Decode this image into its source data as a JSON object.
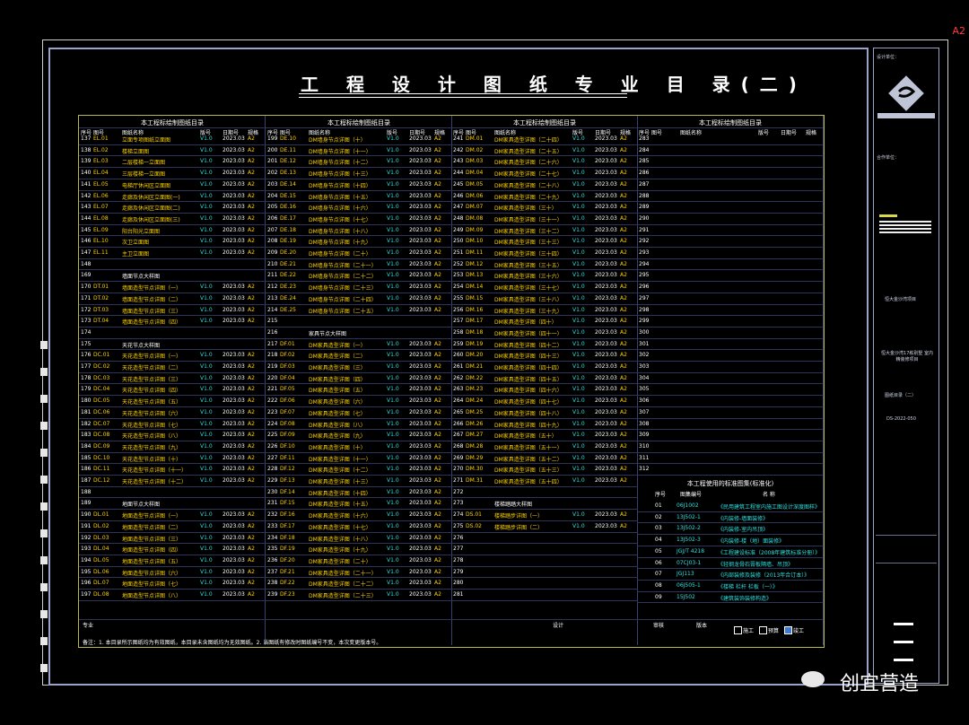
{
  "corner_label": "A2",
  "title": "工 程 设 计 图 纸 专 业 目 录(二)",
  "sections": [
    "本工程标绘制图纸目录",
    "本工程标绘制图纸目录",
    "本工程标绘制图纸目录",
    "本工程标绘制图纸目录"
  ],
  "headers": [
    "序号",
    "图号",
    "图纸名称",
    "版号",
    "日期号",
    "规格"
  ],
  "col1_rows": [
    {
      "n": "137",
      "c": "EL.01",
      "t": "立面专项图纸立面图",
      "v": "V1.0",
      "d": "2023.03",
      "s": "A2"
    },
    {
      "n": "138",
      "c": "EL.02",
      "t": "楼梯立面图",
      "v": "V1.0",
      "d": "2023.03",
      "s": "A2"
    },
    {
      "n": "139",
      "c": "EL.03",
      "t": "二层楼梯一立面图",
      "v": "V1.0",
      "d": "2023.03",
      "s": "A2"
    },
    {
      "n": "140",
      "c": "EL.04",
      "t": "三层楼梯一立面图",
      "v": "V1.0",
      "d": "2023.03",
      "s": "A2"
    },
    {
      "n": "141",
      "c": "EL.05",
      "t": "电梯厅休闲区立面图",
      "v": "V1.0",
      "d": "2023.03",
      "s": "A2"
    },
    {
      "n": "142",
      "c": "EL.06",
      "t": "走廊及休闲区立面图(一)",
      "v": "V1.0",
      "d": "2023.03",
      "s": "A2"
    },
    {
      "n": "143",
      "c": "EL.07",
      "t": "走廊及休闲区立面图(二)",
      "v": "V1.0",
      "d": "2023.03",
      "s": "A2"
    },
    {
      "n": "144",
      "c": "EL.08",
      "t": "走廊及休闲区立面图(三)",
      "v": "V1.0",
      "d": "2023.03",
      "s": "A2"
    },
    {
      "n": "145",
      "c": "EL.09",
      "t": "阳台阳光立面图",
      "v": "V1.0",
      "d": "2023.03",
      "s": "A2"
    },
    {
      "n": "146",
      "c": "EL.10",
      "t": "次卫立面图",
      "v": "V1.0",
      "d": "2023.03",
      "s": "A2"
    },
    {
      "n": "147",
      "c": "EL.11",
      "t": "主卫立面图",
      "v": "V1.0",
      "d": "2023.03",
      "s": "A2"
    },
    {
      "n": "148",
      "c": "",
      "t": "",
      "v": "",
      "d": "",
      "s": ""
    },
    {
      "n": "169",
      "c": "",
      "t": "墙面节点大样图",
      "v": "",
      "d": "",
      "s": ""
    },
    {
      "n": "170",
      "c": "DT.01",
      "t": "墙面造型节点详图（一）",
      "v": "V1.0",
      "d": "2023.03",
      "s": "A2"
    },
    {
      "n": "171",
      "c": "DT.02",
      "t": "墙面造型节点详图（二）",
      "v": "V1.0",
      "d": "2023.03",
      "s": "A2"
    },
    {
      "n": "172",
      "c": "DT.03",
      "t": "墙面造型节点详图（三）",
      "v": "V1.0",
      "d": "2023.03",
      "s": "A2"
    },
    {
      "n": "173",
      "c": "DT.04",
      "t": "墙面造型节点详图（四）",
      "v": "V1.0",
      "d": "2023.03",
      "s": "A2"
    },
    {
      "n": "174",
      "c": "",
      "t": "",
      "v": "",
      "d": "",
      "s": ""
    },
    {
      "n": "175",
      "c": "",
      "t": "天花节点大样图",
      "v": "",
      "d": "",
      "s": ""
    },
    {
      "n": "176",
      "c": "DC.01",
      "t": "天花造型节点详图（一）",
      "v": "V1.0",
      "d": "2023.03",
      "s": "A2"
    },
    {
      "n": "177",
      "c": "DC.02",
      "t": "天花造型节点详图（二）",
      "v": "V1.0",
      "d": "2023.03",
      "s": "A2"
    },
    {
      "n": "178",
      "c": "DC.03",
      "t": "天花造型节点详图（三）",
      "v": "V1.0",
      "d": "2023.03",
      "s": "A2"
    },
    {
      "n": "179",
      "c": "DC.04",
      "t": "天花造型节点详图（四）",
      "v": "V1.0",
      "d": "2023.03",
      "s": "A2"
    },
    {
      "n": "180",
      "c": "DC.05",
      "t": "天花造型节点详图（五）",
      "v": "V1.0",
      "d": "2023.03",
      "s": "A2"
    },
    {
      "n": "181",
      "c": "DC.06",
      "t": "天花造型节点详图（六）",
      "v": "V1.0",
      "d": "2023.03",
      "s": "A2"
    },
    {
      "n": "182",
      "c": "DC.07",
      "t": "天花造型节点详图（七）",
      "v": "V1.0",
      "d": "2023.03",
      "s": "A2"
    },
    {
      "n": "183",
      "c": "DC.08",
      "t": "天花造型节点详图（八）",
      "v": "V1.0",
      "d": "2023.03",
      "s": "A2"
    },
    {
      "n": "184",
      "c": "DC.09",
      "t": "天花造型节点详图（九）",
      "v": "V1.0",
      "d": "2023.03",
      "s": "A2"
    },
    {
      "n": "185",
      "c": "DC.10",
      "t": "天花造型节点详图（十）",
      "v": "V1.0",
      "d": "2023.03",
      "s": "A2"
    },
    {
      "n": "186",
      "c": "DC.11",
      "t": "天花造型节点详图（十一）",
      "v": "V1.0",
      "d": "2023.03",
      "s": "A2"
    },
    {
      "n": "187",
      "c": "DC.12",
      "t": "天花造型节点详图（十二）",
      "v": "V1.0",
      "d": "2023.03",
      "s": "A2"
    },
    {
      "n": "188",
      "c": "",
      "t": "",
      "v": "",
      "d": "",
      "s": ""
    },
    {
      "n": "189",
      "c": "",
      "t": "地面节点大样图",
      "v": "",
      "d": "",
      "s": ""
    },
    {
      "n": "190",
      "c": "DL.01",
      "t": "地面造型节点详图（一）",
      "v": "V1.0",
      "d": "2023.03",
      "s": "A2"
    },
    {
      "n": "191",
      "c": "DL.02",
      "t": "地面造型节点详图（二）",
      "v": "V1.0",
      "d": "2023.03",
      "s": "A2"
    },
    {
      "n": "192",
      "c": "DL.03",
      "t": "地面造型节点详图（三）",
      "v": "V1.0",
      "d": "2023.03",
      "s": "A2"
    },
    {
      "n": "193",
      "c": "DL.04",
      "t": "地面造型节点详图（四）",
      "v": "V1.0",
      "d": "2023.03",
      "s": "A2"
    },
    {
      "n": "194",
      "c": "DL.05",
      "t": "地面造型节点详图（五）",
      "v": "V1.0",
      "d": "2023.03",
      "s": "A2"
    },
    {
      "n": "195",
      "c": "DL.06",
      "t": "地面造型节点详图（六）",
      "v": "V1.0",
      "d": "2023.03",
      "s": "A2"
    },
    {
      "n": "196",
      "c": "DL.07",
      "t": "地面造型节点详图（七）",
      "v": "V1.0",
      "d": "2023.03",
      "s": "A2"
    },
    {
      "n": "197",
      "c": "DL.08",
      "t": "地面造型节点详图（八）",
      "v": "V1.0",
      "d": "2023.03",
      "s": "A2"
    }
  ],
  "col2_rows": [
    {
      "n": "199",
      "c": "DE.10",
      "t": "DM墙身节点详图（十）",
      "v": "V1.0",
      "d": "2023.03",
      "s": "A2"
    },
    {
      "n": "200",
      "c": "DE.11",
      "t": "DM墙身节点详图（十一）",
      "v": "V1.0",
      "d": "2023.03",
      "s": "A2"
    },
    {
      "n": "201",
      "c": "DE.12",
      "t": "DM墙身节点详图（十二）",
      "v": "V1.0",
      "d": "2023.03",
      "s": "A2"
    },
    {
      "n": "202",
      "c": "DE.13",
      "t": "DM墙身节点详图（十三）",
      "v": "V1.0",
      "d": "2023.03",
      "s": "A2"
    },
    {
      "n": "203",
      "c": "DE.14",
      "t": "DM墙身节点详图（十四）",
      "v": "V1.0",
      "d": "2023.03",
      "s": "A2"
    },
    {
      "n": "204",
      "c": "DE.15",
      "t": "DM墙身节点详图（十五）",
      "v": "V1.0",
      "d": "2023.03",
      "s": "A2"
    },
    {
      "n": "205",
      "c": "DE.16",
      "t": "DM墙身节点详图（十六）",
      "v": "V1.0",
      "d": "2023.03",
      "s": "A2"
    },
    {
      "n": "206",
      "c": "DE.17",
      "t": "DM墙身节点详图（十七）",
      "v": "V1.0",
      "d": "2023.03",
      "s": "A2"
    },
    {
      "n": "207",
      "c": "DE.18",
      "t": "DM墙身节点详图（十八）",
      "v": "V1.0",
      "d": "2023.03",
      "s": "A2"
    },
    {
      "n": "208",
      "c": "DE.19",
      "t": "DM墙身节点详图（十九）",
      "v": "V1.0",
      "d": "2023.03",
      "s": "A2"
    },
    {
      "n": "209",
      "c": "DE.20",
      "t": "DM墙身节点详图（二十）",
      "v": "V1.0",
      "d": "2023.03",
      "s": "A2"
    },
    {
      "n": "210",
      "c": "DE.21",
      "t": "DM墙身节点详图（二十一）",
      "v": "V1.0",
      "d": "2023.03",
      "s": "A2"
    },
    {
      "n": "211",
      "c": "DE.22",
      "t": "DM墙身节点详图（二十二）",
      "v": "V1.0",
      "d": "2023.03",
      "s": "A2"
    },
    {
      "n": "212",
      "c": "DE.23",
      "t": "DM墙身节点详图（二十三）",
      "v": "V1.0",
      "d": "2023.03",
      "s": "A2"
    },
    {
      "n": "213",
      "c": "DE.24",
      "t": "DM墙身节点详图（二十四）",
      "v": "V1.0",
      "d": "2023.03",
      "s": "A2"
    },
    {
      "n": "214",
      "c": "DE.25",
      "t": "DM墙身节点详图（二十五）",
      "v": "V1.0",
      "d": "2023.03",
      "s": "A2"
    },
    {
      "n": "215",
      "c": "",
      "t": "",
      "v": "",
      "d": "",
      "s": ""
    },
    {
      "n": "216",
      "c": "",
      "t": "家具节点大样图",
      "v": "",
      "d": "",
      "s": ""
    },
    {
      "n": "217",
      "c": "DF.01",
      "t": "DM家具造型详图（一）",
      "v": "V1.0",
      "d": "2023.03",
      "s": "A2"
    },
    {
      "n": "218",
      "c": "DF.02",
      "t": "DM家具造型详图（二）",
      "v": "V1.0",
      "d": "2023.03",
      "s": "A2"
    },
    {
      "n": "219",
      "c": "DF.03",
      "t": "DM家具造型详图（三）",
      "v": "V1.0",
      "d": "2023.03",
      "s": "A2"
    },
    {
      "n": "220",
      "c": "DF.04",
      "t": "DM家具造型详图（四）",
      "v": "V1.0",
      "d": "2023.03",
      "s": "A2"
    },
    {
      "n": "221",
      "c": "DF.05",
      "t": "DM家具造型详图（五）",
      "v": "V1.0",
      "d": "2023.03",
      "s": "A2"
    },
    {
      "n": "222",
      "c": "DF.06",
      "t": "DM家具造型详图（六）",
      "v": "V1.0",
      "d": "2023.03",
      "s": "A2"
    },
    {
      "n": "223",
      "c": "DF.07",
      "t": "DM家具造型详图（七）",
      "v": "V1.0",
      "d": "2023.03",
      "s": "A2"
    },
    {
      "n": "224",
      "c": "DF.08",
      "t": "DM家具造型详图（八）",
      "v": "V1.0",
      "d": "2023.03",
      "s": "A2"
    },
    {
      "n": "225",
      "c": "DF.09",
      "t": "DM家具造型详图（九）",
      "v": "V1.0",
      "d": "2023.03",
      "s": "A2"
    },
    {
      "n": "226",
      "c": "DF.10",
      "t": "DM家具造型详图（十）",
      "v": "V1.0",
      "d": "2023.03",
      "s": "A2"
    },
    {
      "n": "227",
      "c": "DF.11",
      "t": "DM家具造型详图（十一）",
      "v": "V1.0",
      "d": "2023.03",
      "s": "A2"
    },
    {
      "n": "228",
      "c": "DF.12",
      "t": "DM家具造型详图（十二）",
      "v": "V1.0",
      "d": "2023.03",
      "s": "A2"
    },
    {
      "n": "229",
      "c": "DF.13",
      "t": "DM家具造型详图（十三）",
      "v": "V1.0",
      "d": "2023.03",
      "s": "A2"
    },
    {
      "n": "230",
      "c": "DF.14",
      "t": "DM家具造型详图（十四）",
      "v": "V1.0",
      "d": "2023.03",
      "s": "A2"
    },
    {
      "n": "231",
      "c": "DF.15",
      "t": "DM家具造型详图（十五）",
      "v": "V1.0",
      "d": "2023.03",
      "s": "A2"
    },
    {
      "n": "232",
      "c": "DF.16",
      "t": "DM家具造型详图（十六）",
      "v": "V1.0",
      "d": "2023.03",
      "s": "A2"
    },
    {
      "n": "233",
      "c": "DF.17",
      "t": "DM家具造型详图（十七）",
      "v": "V1.0",
      "d": "2023.03",
      "s": "A2"
    },
    {
      "n": "234",
      "c": "DF.18",
      "t": "DM家具造型详图（十八）",
      "v": "V1.0",
      "d": "2023.03",
      "s": "A2"
    },
    {
      "n": "235",
      "c": "DF.19",
      "t": "DM家具造型详图（十九）",
      "v": "V1.0",
      "d": "2023.03",
      "s": "A2"
    },
    {
      "n": "236",
      "c": "DF.20",
      "t": "DM家具造型详图（二十）",
      "v": "V1.0",
      "d": "2023.03",
      "s": "A2"
    },
    {
      "n": "237",
      "c": "DF.21",
      "t": "DM家具造型详图（二十一）",
      "v": "V1.0",
      "d": "2023.03",
      "s": "A2"
    },
    {
      "n": "238",
      "c": "DF.22",
      "t": "DM家具造型详图（二十二）",
      "v": "V1.0",
      "d": "2023.03",
      "s": "A2"
    },
    {
      "n": "239",
      "c": "DF.23",
      "t": "DM家具造型详图（二十三）",
      "v": "V1.0",
      "d": "2023.03",
      "s": "A2"
    }
  ],
  "col3_rows": [
    {
      "n": "241",
      "c": "DM.01",
      "t": "DM家具造型详图（二十四）",
      "v": "V1.0",
      "d": "2023.03",
      "s": "A2"
    },
    {
      "n": "242",
      "c": "DM.02",
      "t": "DM家具造型详图（二十五）",
      "v": "V1.0",
      "d": "2023.03",
      "s": "A2"
    },
    {
      "n": "243",
      "c": "DM.03",
      "t": "DM家具造型详图（二十六）",
      "v": "V1.0",
      "d": "2023.03",
      "s": "A2"
    },
    {
      "n": "244",
      "c": "DM.04",
      "t": "DM家具造型详图（二十七）",
      "v": "V1.0",
      "d": "2023.03",
      "s": "A2"
    },
    {
      "n": "245",
      "c": "DM.05",
      "t": "DM家具造型详图（二十八）",
      "v": "V1.0",
      "d": "2023.03",
      "s": "A2"
    },
    {
      "n": "246",
      "c": "DM.06",
      "t": "DM家具造型详图（二十九）",
      "v": "V1.0",
      "d": "2023.03",
      "s": "A2"
    },
    {
      "n": "247",
      "c": "DM.07",
      "t": "DM家具造型详图（三十）",
      "v": "V1.0",
      "d": "2023.03",
      "s": "A2"
    },
    {
      "n": "248",
      "c": "DM.08",
      "t": "DM家具造型详图（三十一）",
      "v": "V1.0",
      "d": "2023.03",
      "s": "A2"
    },
    {
      "n": "249",
      "c": "DM.09",
      "t": "DM家具造型详图（三十二）",
      "v": "V1.0",
      "d": "2023.03",
      "s": "A2"
    },
    {
      "n": "250",
      "c": "DM.10",
      "t": "DM家具造型详图（三十三）",
      "v": "V1.0",
      "d": "2023.03",
      "s": "A2"
    },
    {
      "n": "251",
      "c": "DM.11",
      "t": "DM家具造型详图（三十四）",
      "v": "V1.0",
      "d": "2023.03",
      "s": "A2"
    },
    {
      "n": "252",
      "c": "DM.12",
      "t": "DM家具造型详图（三十五）",
      "v": "V1.0",
      "d": "2023.03",
      "s": "A2"
    },
    {
      "n": "253",
      "c": "DM.13",
      "t": "DM家具造型详图（三十六）",
      "v": "V1.0",
      "d": "2023.03",
      "s": "A2"
    },
    {
      "n": "254",
      "c": "DM.14",
      "t": "DM家具造型详图（三十七）",
      "v": "V1.0",
      "d": "2023.03",
      "s": "A2"
    },
    {
      "n": "255",
      "c": "DM.15",
      "t": "DM家具造型详图（三十八）",
      "v": "V1.0",
      "d": "2023.03",
      "s": "A2"
    },
    {
      "n": "256",
      "c": "DM.16",
      "t": "DM家具造型详图（三十九）",
      "v": "V1.0",
      "d": "2023.03",
      "s": "A2"
    },
    {
      "n": "257",
      "c": "DM.17",
      "t": "DM家具造型详图（四十）",
      "v": "V1.0",
      "d": "2023.03",
      "s": "A2"
    },
    {
      "n": "258",
      "c": "DM.18",
      "t": "DM家具造型详图（四十一）",
      "v": "V1.0",
      "d": "2023.03",
      "s": "A2"
    },
    {
      "n": "259",
      "c": "DM.19",
      "t": "DM家具造型详图（四十二）",
      "v": "V1.0",
      "d": "2023.03",
      "s": "A2"
    },
    {
      "n": "260",
      "c": "DM.20",
      "t": "DM家具造型详图（四十三）",
      "v": "V1.0",
      "d": "2023.03",
      "s": "A2"
    },
    {
      "n": "261",
      "c": "DM.21",
      "t": "DM家具造型详图（四十四）",
      "v": "V1.0",
      "d": "2023.03",
      "s": "A2"
    },
    {
      "n": "262",
      "c": "DM.22",
      "t": "DM家具造型详图（四十五）",
      "v": "V1.0",
      "d": "2023.03",
      "s": "A2"
    },
    {
      "n": "263",
      "c": "DM.23",
      "t": "DM家具造型详图（四十六）",
      "v": "V1.0",
      "d": "2023.03",
      "s": "A2"
    },
    {
      "n": "264",
      "c": "DM.24",
      "t": "DM家具造型详图（四十七）",
      "v": "V1.0",
      "d": "2023.03",
      "s": "A2"
    },
    {
      "n": "265",
      "c": "DM.25",
      "t": "DM家具造型详图（四十八）",
      "v": "V1.0",
      "d": "2023.03",
      "s": "A2"
    },
    {
      "n": "266",
      "c": "DM.26",
      "t": "DM家具造型详图（四十九）",
      "v": "V1.0",
      "d": "2023.03",
      "s": "A2"
    },
    {
      "n": "267",
      "c": "DM.27",
      "t": "DM家具造型详图（五十）",
      "v": "V1.0",
      "d": "2023.03",
      "s": "A2"
    },
    {
      "n": "268",
      "c": "DM.28",
      "t": "DM家具造型详图（五十一）",
      "v": "V1.0",
      "d": "2023.03",
      "s": "A2"
    },
    {
      "n": "269",
      "c": "DM.29",
      "t": "DM家具造型详图（五十二）",
      "v": "V1.0",
      "d": "2023.03",
      "s": "A2"
    },
    {
      "n": "270",
      "c": "DM.30",
      "t": "DM家具造型详图（五十三）",
      "v": "V1.0",
      "d": "2023.03",
      "s": "A2"
    },
    {
      "n": "271",
      "c": "DM.31",
      "t": "DM家具造型详图（五十四）",
      "v": "V1.0",
      "d": "2023.03",
      "s": "A2"
    },
    {
      "n": "272",
      "c": "",
      "t": "",
      "v": "",
      "d": "",
      "s": ""
    },
    {
      "n": "273",
      "c": "",
      "t": "楼梯踏踏大样图",
      "v": "",
      "d": "",
      "s": ""
    },
    {
      "n": "274",
      "c": "DS.01",
      "t": "楼梯踏步详图（一）",
      "v": "V1.0",
      "d": "2023.03",
      "s": "A2"
    },
    {
      "n": "275",
      "c": "DS.02",
      "t": "楼梯踏步详图（二）",
      "v": "V1.0",
      "d": "2023.03",
      "s": "A2"
    },
    {
      "n": "276",
      "c": "",
      "t": "",
      "v": "",
      "d": "",
      "s": ""
    },
    {
      "n": "277",
      "c": "",
      "t": "",
      "v": "",
      "d": "",
      "s": ""
    },
    {
      "n": "278",
      "c": "",
      "t": "",
      "v": "",
      "d": "",
      "s": ""
    },
    {
      "n": "279",
      "c": "",
      "t": "",
      "v": "",
      "d": "",
      "s": ""
    },
    {
      "n": "280",
      "c": "",
      "t": "",
      "v": "",
      "d": "",
      "s": ""
    },
    {
      "n": "281",
      "c": "",
      "t": "",
      "v": "",
      "d": "",
      "s": ""
    }
  ],
  "col4_nums": [
    "283",
    "284",
    "285",
    "286",
    "287",
    "288",
    "289",
    "290",
    "291",
    "292",
    "293",
    "294",
    "295",
    "296",
    "297",
    "298",
    "299",
    "300",
    "301",
    "302",
    "303",
    "304",
    "305",
    "306",
    "307",
    "308",
    "309",
    "310",
    "311",
    "312"
  ],
  "standards_title": "本工程使用的标准图集(标准化)",
  "standards_headers": [
    "序号",
    "图集编号",
    "名  称"
  ],
  "standards": [
    {
      "n": "01",
      "c": "06J1002",
      "t": "《民用建筑工程室内施工图设计深度图样》"
    },
    {
      "n": "02",
      "c": "13J502-1",
      "t": "《内装修-墙面装修》"
    },
    {
      "n": "03",
      "c": "13J502-2",
      "t": "《内装修-室内吊顶》"
    },
    {
      "n": "04",
      "c": "13J502-3",
      "t": "《内装修-楼（地）面装修》"
    },
    {
      "n": "05",
      "c": "JGJ/T 4218",
      "t": "《工程建设标准（2008年建筑标准分册）》"
    },
    {
      "n": "06",
      "c": "07CJ03-1",
      "t": "《轻钢龙骨石膏板隔墙、吊顶》"
    },
    {
      "n": "07",
      "c": "JGJ113",
      "t": "《内部装修及装修（2013年合订本）》"
    },
    {
      "n": "08",
      "c": "06J505-1",
      "t": "《楼梯 栏杆 栏板（一）》"
    },
    {
      "n": "09",
      "c": "15J502",
      "t": "《建筑装饰装修构造》"
    }
  ],
  "footer": {
    "label1": "专业",
    "label2": "设计",
    "label3": "审核",
    "label4": "版本",
    "opt1": "施工",
    "opt2": "预算",
    "opt3": "竣工"
  },
  "note": "备注：1. 本目录所示图纸均为有效图纸，本目录未含图纸均为无效图纸。2. 当图纸有修改时图纸编号不变，本次变更版本号。",
  "title_block": {
    "design_unit": "设计单位：",
    "cooperate_unit": "合作单位：",
    "project": "恒大金沙湾项目",
    "subproject": "恒大金沙湾17栋别墅 室内精装修项目",
    "drawing_name": "图纸目录（二）",
    "drawing_no": "DS-2022-050"
  },
  "watermark_text": "创宜营造"
}
